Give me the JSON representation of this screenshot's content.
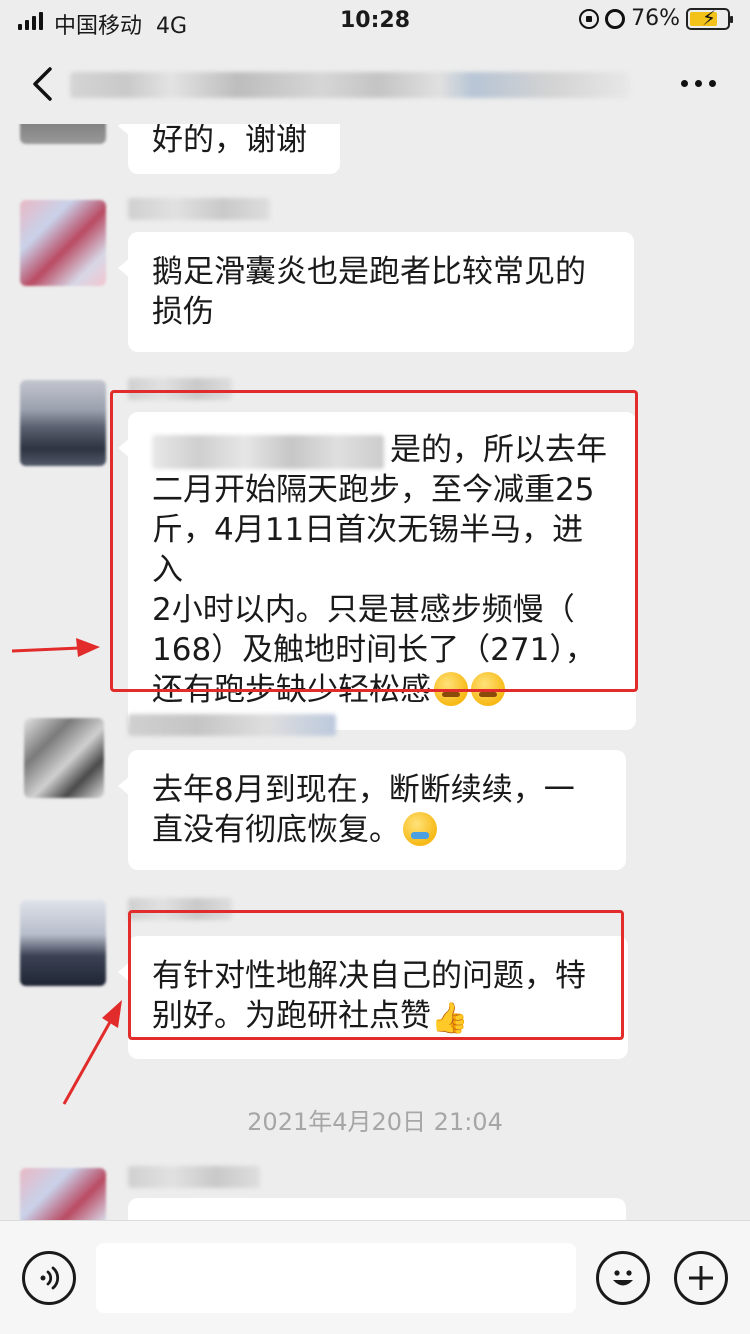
{
  "status_bar": {
    "carrier": "中国移动",
    "network": "4G",
    "time": "10:28",
    "battery_percent": "76%",
    "battery_level": 0.76
  },
  "nav": {
    "back_icon": "chevron-left-icon",
    "more_icon": "more-dots-icon"
  },
  "messages": [
    {
      "text": "好的，谢谢"
    },
    {
      "text_lines": [
        "鹅足滑囊炎也是跑者比较常见的",
        "损伤"
      ]
    },
    {
      "text_lines": [
        "是的，所以去年",
        "二月开始隔天跑步，至今减重25",
        "斤，4月11日首次无锡半马，进入",
        "2小时以内。只是甚感步频慢（",
        "168）及触地时间长了（271），",
        "还有跑步缺少轻松感"
      ],
      "highlighted": true
    },
    {
      "text_lines": [
        "去年8月到现在，断断续续，一",
        "直没有彻底恢复。"
      ]
    },
    {
      "text_lines": [
        "有针对性地解决自己的问题，特",
        "别好。为跑研社点赞"
      ],
      "highlighted": true
    }
  ],
  "timestamp": "2021年4月20日 21:04",
  "colors": {
    "background": "#ededed",
    "bubble": "#ffffff",
    "highlight": "#e22b2b",
    "battery": "#f2c21b"
  }
}
